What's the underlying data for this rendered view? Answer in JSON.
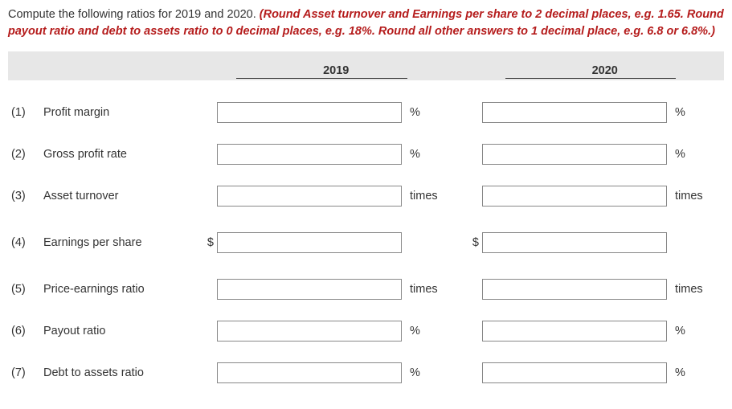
{
  "instructions": {
    "lead": "Compute the following ratios for 2019 and 2020. ",
    "emph": "(Round Asset turnover and Earnings per share to 2 decimal places, e.g. 1.65. Round payout ratio and debt to assets ratio to 0 decimal places, e.g. 18%. Round all other answers to 1 decimal place, e.g. 6.8 or 6.8%.)"
  },
  "years": {
    "y1": "2019",
    "y2": "2020"
  },
  "rows": [
    {
      "num": "(1)",
      "label": "Profit margin",
      "prefix": "",
      "unit": "%",
      "val1": "",
      "val2": ""
    },
    {
      "num": "(2)",
      "label": "Gross profit rate",
      "prefix": "",
      "unit": "%",
      "val1": "",
      "val2": ""
    },
    {
      "num": "(3)",
      "label": "Asset turnover",
      "prefix": "",
      "unit": "times",
      "val1": "",
      "val2": ""
    },
    {
      "num": "(4)",
      "label": "Earnings per share",
      "prefix": "$",
      "unit": "",
      "val1": "",
      "val2": ""
    },
    {
      "num": "(5)",
      "label": "Price-earnings ratio",
      "prefix": "",
      "unit": "times",
      "val1": "",
      "val2": ""
    },
    {
      "num": "(6)",
      "label": "Payout ratio",
      "prefix": "",
      "unit": "%",
      "val1": "",
      "val2": ""
    },
    {
      "num": "(7)",
      "label": "Debt to assets ratio",
      "prefix": "",
      "unit": "%",
      "val1": "",
      "val2": ""
    }
  ]
}
